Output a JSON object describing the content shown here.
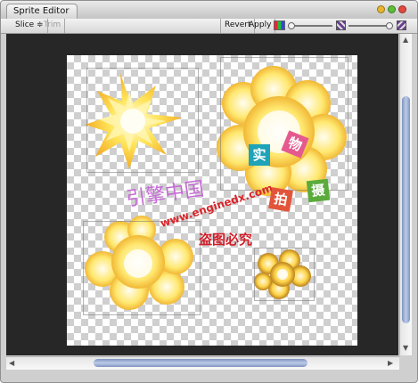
{
  "window": {
    "tab_title": "Sprite Editor",
    "colors": {
      "close": "#e2493f",
      "minimize": "#e8b52e",
      "zoom": "#5cbf38"
    }
  },
  "toolbar": {
    "slice_label": "Slice ≑",
    "trim_label": "Trim",
    "revert_label": "Revert",
    "apply_label": "Apply"
  },
  "sprite_sheet": {
    "image": "explosion sprite sheet (4 cells) on transparent checkerboard",
    "watermark": {
      "brand": "引擎中国",
      "url": "www.enginedx.com",
      "notice": "盗图必究",
      "boxes": [
        {
          "char": "实",
          "color": "#1ea3b8"
        },
        {
          "char": "物",
          "color": "#e45a8f"
        },
        {
          "char": "拍",
          "color": "#e2553a"
        },
        {
          "char": "摄",
          "color": "#5aab3c"
        }
      ]
    }
  }
}
